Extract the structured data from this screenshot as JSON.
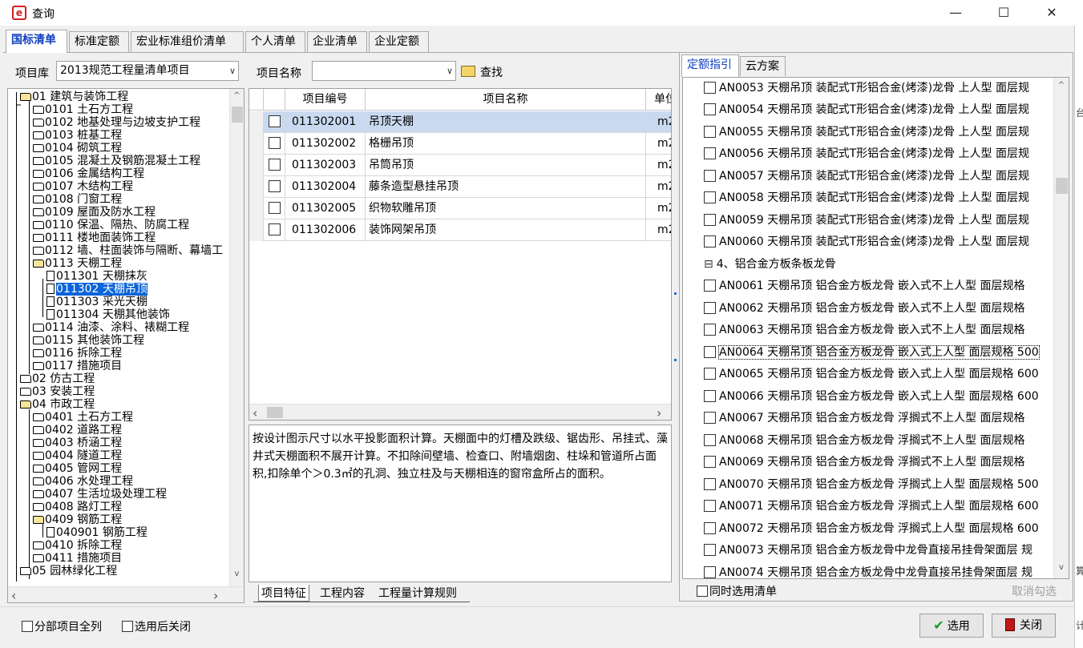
{
  "window": {
    "title": "查询",
    "minimize": "—",
    "maximize": "☐",
    "close": "✕"
  },
  "top_tabs": [
    "国标清单",
    "标准定额",
    "宏业标准组价清单",
    "个人清单",
    "企业清单",
    "企业定额"
  ],
  "left": {
    "library_label": "项目库",
    "library_value": "2013规范工程量清单项目",
    "tree": [
      {
        "t": "01 建筑与装饰工程",
        "lv": 0,
        "icon": "open"
      },
      {
        "t": "0101 土石方工程",
        "lv": 1,
        "icon": "folder"
      },
      {
        "t": "0102 地基处理与边坡支护工程",
        "lv": 1,
        "icon": "folder"
      },
      {
        "t": "0103 桩基工程",
        "lv": 1,
        "icon": "folder"
      },
      {
        "t": "0104 砌筑工程",
        "lv": 1,
        "icon": "folder"
      },
      {
        "t": "0105 混凝土及钢筋混凝土工程",
        "lv": 1,
        "icon": "folder"
      },
      {
        "t": "0106 金属结构工程",
        "lv": 1,
        "icon": "folder"
      },
      {
        "t": "0107 木结构工程",
        "lv": 1,
        "icon": "folder"
      },
      {
        "t": "0108 门窗工程",
        "lv": 1,
        "icon": "folder"
      },
      {
        "t": "0109 屋面及防水工程",
        "lv": 1,
        "icon": "folder"
      },
      {
        "t": "0110 保温、隔热、防腐工程",
        "lv": 1,
        "icon": "folder"
      },
      {
        "t": "0111 楼地面装饰工程",
        "lv": 1,
        "icon": "folder"
      },
      {
        "t": "0112 墙、柱面装饰与隔断、幕墙工",
        "lv": 1,
        "icon": "folder"
      },
      {
        "t": "0113 天棚工程",
        "lv": 1,
        "icon": "open"
      },
      {
        "t": "011301 天棚抹灰",
        "lv": 2,
        "icon": "doc"
      },
      {
        "t": "011302 天棚吊顶",
        "lv": 2,
        "icon": "doc",
        "selected": true
      },
      {
        "t": "011303 采光天棚",
        "lv": 2,
        "icon": "doc"
      },
      {
        "t": "011304 天棚其他装饰",
        "lv": 2,
        "icon": "doc"
      },
      {
        "t": "0114 油漆、涂料、裱糊工程",
        "lv": 1,
        "icon": "folder"
      },
      {
        "t": "0115 其他装饰工程",
        "lv": 1,
        "icon": "folder"
      },
      {
        "t": "0116 拆除工程",
        "lv": 1,
        "icon": "folder"
      },
      {
        "t": "0117 措施项目",
        "lv": 1,
        "icon": "folder"
      },
      {
        "t": "02 仿古工程",
        "lv": 0,
        "icon": "folder"
      },
      {
        "t": "03 安装工程",
        "lv": 0,
        "icon": "folder"
      },
      {
        "t": "04 市政工程",
        "lv": 0,
        "icon": "open"
      },
      {
        "t": "0401 土石方工程",
        "lv": 1,
        "icon": "folder"
      },
      {
        "t": "0402 道路工程",
        "lv": 1,
        "icon": "folder"
      },
      {
        "t": "0403 桥涵工程",
        "lv": 1,
        "icon": "folder"
      },
      {
        "t": "0404 隧道工程",
        "lv": 1,
        "icon": "folder"
      },
      {
        "t": "0405 管网工程",
        "lv": 1,
        "icon": "folder"
      },
      {
        "t": "0406 水处理工程",
        "lv": 1,
        "icon": "folder"
      },
      {
        "t": "0407 生活垃圾处理工程",
        "lv": 1,
        "icon": "folder"
      },
      {
        "t": "0408 路灯工程",
        "lv": 1,
        "icon": "folder"
      },
      {
        "t": "0409 钢筋工程",
        "lv": 1,
        "icon": "open"
      },
      {
        "t": "040901 钢筋工程",
        "lv": 2,
        "icon": "doc"
      },
      {
        "t": "0410 拆除工程",
        "lv": 1,
        "icon": "folder"
      },
      {
        "t": "0411 措施项目",
        "lv": 1,
        "icon": "folder"
      },
      {
        "t": "05 园林绿化工程",
        "lv": 0,
        "icon": "folder"
      }
    ],
    "scroll_left": "‹",
    "scroll_right": "›",
    "scroll_up": "^",
    "scroll_down": "v"
  },
  "middle": {
    "name_label": "项目名称",
    "name_value": "",
    "search_label": "查找",
    "columns": [
      "项目编号",
      "项目名称",
      "单位"
    ],
    "rows": [
      {
        "code": "011302001",
        "name": "吊顶天棚",
        "unit": "m2",
        "highlight": true
      },
      {
        "code": "011302002",
        "name": "格栅吊顶",
        "unit": "m2"
      },
      {
        "code": "011302003",
        "name": "吊筒吊顶",
        "unit": "m2"
      },
      {
        "code": "011302004",
        "name": "藤条造型悬挂吊顶",
        "unit": "m2"
      },
      {
        "code": "011302005",
        "name": "织物软雕吊顶",
        "unit": "m2"
      },
      {
        "code": "011302006",
        "name": "装饰网架吊顶",
        "unit": "m2"
      }
    ],
    "description": "按设计图示尺寸以水平投影面积计算。天棚面中的灯槽及跌级、锯齿形、吊挂式、藻井式天棚面积不展开计算。不扣除间壁墙、检查口、附墙烟囱、柱垛和管道所占面积,扣除单个＞0.3㎡的孔洞、独立柱及与天棚相连的窗帘盒所占的面积。",
    "bottom_tabs": [
      "项目特征",
      "工程内容",
      "工程量计算规则"
    ]
  },
  "right": {
    "tabs": [
      "定额指引",
      "云方案"
    ],
    "items": [
      {
        "t": "AN0053 天棚吊顶 装配式T形铝合金(烤漆)龙骨 上人型 面层规"
      },
      {
        "t": "AN0054 天棚吊顶 装配式T形铝合金(烤漆)龙骨 上人型 面层规"
      },
      {
        "t": "AN0055 天棚吊顶 装配式T形铝合金(烤漆)龙骨 上人型 面层规"
      },
      {
        "t": "AN0056 天棚吊顶 装配式T形铝合金(烤漆)龙骨 上人型 面层规"
      },
      {
        "t": "AN0057 天棚吊顶 装配式T形铝合金(烤漆)龙骨 上人型 面层规"
      },
      {
        "t": "AN0058 天棚吊顶 装配式T形铝合金(烤漆)龙骨 上人型 面层规"
      },
      {
        "t": "AN0059 天棚吊顶 装配式T形铝合金(烤漆)龙骨 上人型 面层规"
      },
      {
        "t": "AN0060 天棚吊顶 装配式T形铝合金(烤漆)龙骨 上人型 面层规"
      },
      {
        "t": "4、铝合金方板条板龙骨",
        "group": true
      },
      {
        "t": "AN0061 天棚吊顶 铝合金方板龙骨 嵌入式不上人型 面层规格"
      },
      {
        "t": "AN0062 天棚吊顶 铝合金方板龙骨 嵌入式不上人型 面层规格"
      },
      {
        "t": "AN0063 天棚吊顶 铝合金方板龙骨 嵌入式不上人型 面层规格"
      },
      {
        "t": "AN0064 天棚吊顶 铝合金方板龙骨 嵌入式上人型 面层规格 500",
        "focused": true
      },
      {
        "t": "AN0065 天棚吊顶 铝合金方板龙骨 嵌入式上人型 面层规格 600"
      },
      {
        "t": "AN0066 天棚吊顶 铝合金方板龙骨 嵌入式上人型 面层规格 600"
      },
      {
        "t": "AN0067 天棚吊顶 铝合金方板龙骨 浮搁式不上人型 面层规格"
      },
      {
        "t": "AN0068 天棚吊顶 铝合金方板龙骨 浮搁式不上人型 面层规格"
      },
      {
        "t": "AN0069 天棚吊顶 铝合金方板龙骨 浮搁式不上人型 面层规格"
      },
      {
        "t": "AN0070 天棚吊顶 铝合金方板龙骨 浮搁式上人型 面层规格 500"
      },
      {
        "t": "AN0071 天棚吊顶 铝合金方板龙骨 浮搁式上人型 面层规格 600"
      },
      {
        "t": "AN0072 天棚吊顶 铝合金方板龙骨 浮搁式上人型 面层规格 600"
      },
      {
        "t": "AN0073 天棚吊顶 铝合金方板龙骨中龙骨直接吊挂骨架面层 规"
      },
      {
        "t": "AN0074 天棚吊顶 铝合金方板龙骨中龙骨直接吊挂骨架面层 规"
      }
    ],
    "group_toggle": "⊟",
    "also_select_label": "同时选用清单",
    "cancel_check_label": "取消勾选"
  },
  "bottom": {
    "expand_all_label": "分部项目全列",
    "close_after_label": "选用后关闭",
    "select_button": "选用",
    "close_button": "关闭",
    "colors": {
      "check": "#1a9a2a",
      "close_icon": "#c01818"
    }
  },
  "edge_strip": [
    "台",
    "算",
    "计"
  ]
}
